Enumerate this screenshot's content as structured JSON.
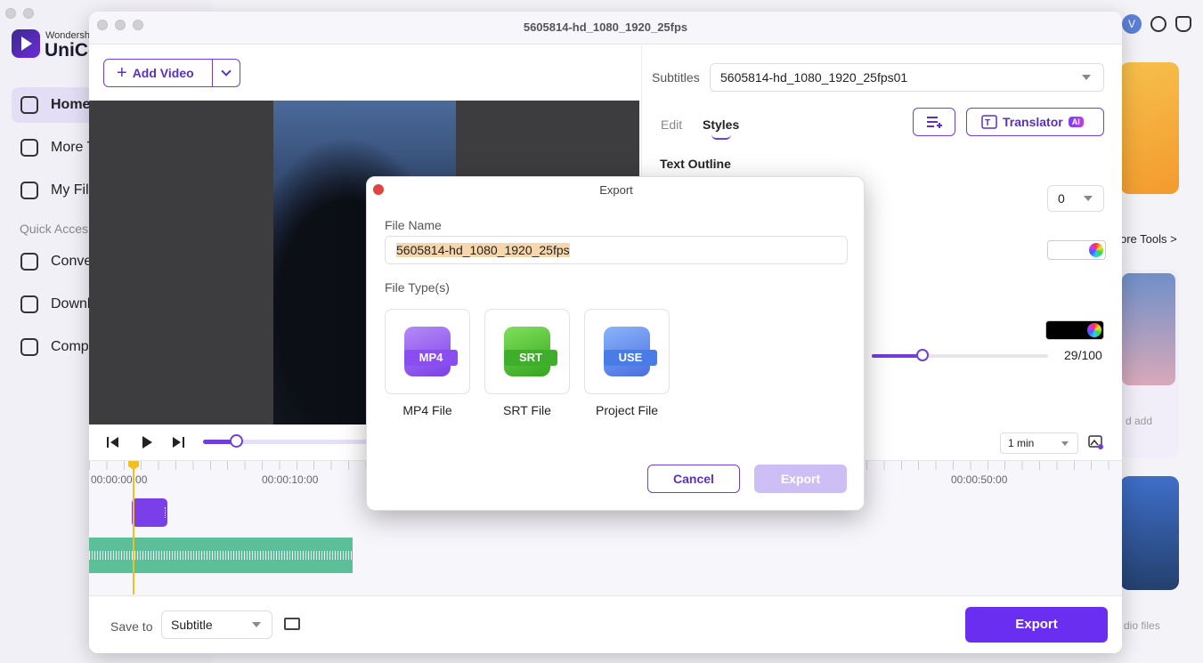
{
  "background": {
    "brand_small": "Wondersh",
    "brand_big": "UniCo",
    "nav": [
      {
        "label": "Home"
      },
      {
        "label": "More T"
      },
      {
        "label": "My Fil"
      }
    ],
    "quick_access_label": "Quick Acces",
    "quick_items": [
      {
        "label": "Conve"
      },
      {
        "label": "Downl"
      },
      {
        "label": "Comp"
      }
    ],
    "avatar_letter": "V",
    "more_tools": "ore Tools >",
    "card_text_1": "d add",
    "card_text_2": "dio files"
  },
  "window": {
    "title": "5605814-hd_1080_1920_25fps",
    "add_video_label": "Add Video"
  },
  "right_panel": {
    "subtitles_label": "Subtitles",
    "subtitles_value": "5605814-hd_1080_1920_25fps01",
    "tab_edit": "Edit",
    "tab_styles": "Styles",
    "translator_label": "Translator",
    "ai_badge": "AI",
    "text_outline_label": "Text Outline",
    "outline_width_value": "0",
    "opacity_value": "29/100",
    "opacity_fraction": 0.29,
    "outline_color": "#ffffff",
    "shadow_color": "#000000"
  },
  "player": {
    "progress_fraction": 0.19
  },
  "timeline": {
    "zoom_value": "1 min",
    "time_labels": [
      "00:00:00:00",
      "00:00:10:00",
      "00:00:50:00"
    ]
  },
  "footer": {
    "save_to_label": "Save to",
    "save_to_value": "Subtitle",
    "export_label": "Export"
  },
  "export_dialog": {
    "title": "Export",
    "file_name_label": "File Name",
    "file_name_value": "5605814-hd_1080_1920_25fps",
    "file_types_label": "File Type(s)",
    "file_types": [
      {
        "tag": "MP4",
        "label": "MP4 File",
        "color": "#8a4df0"
      },
      {
        "tag": "SRT",
        "label": "SRT File",
        "color": "#3fae2a"
      },
      {
        "tag": "USE",
        "label": "Project File",
        "color": "#4a7ce8"
      }
    ],
    "cancel_label": "Cancel",
    "export_label": "Export"
  },
  "colors": {
    "accent": "#6a2ef0",
    "audio_clip": "#5bbf9a",
    "playhead": "#f0c020"
  }
}
